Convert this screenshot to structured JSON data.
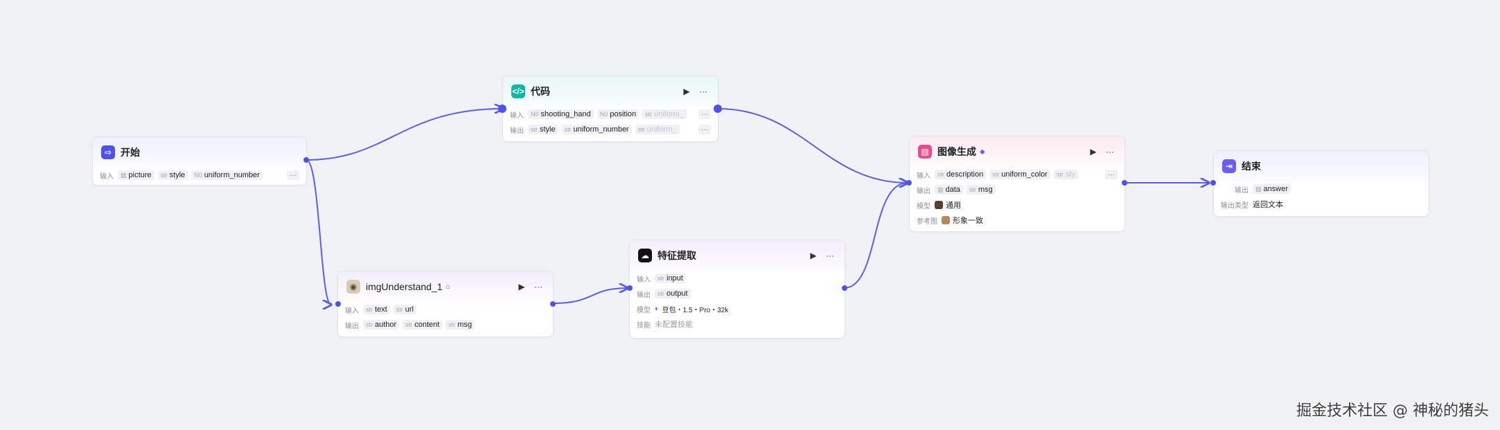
{
  "nodes": {
    "start": {
      "title": "开始",
      "input_label": "输入",
      "inputs": [
        {
          "type": "img",
          "name": "picture"
        },
        {
          "type": "str",
          "name": "style"
        },
        {
          "type": "N0",
          "name": "uniform_number"
        }
      ],
      "more": "···"
    },
    "code": {
      "title": "代码",
      "input_label": "输入",
      "output_label": "输出",
      "inputs": [
        {
          "type": "N0",
          "name": "shooting_hand"
        },
        {
          "type": "N0",
          "name": "position"
        },
        {
          "type": "str",
          "name": "uniform_"
        }
      ],
      "outputs": [
        {
          "type": "str",
          "name": "style"
        },
        {
          "type": "str",
          "name": "uniform_number"
        },
        {
          "type": "str",
          "name": "uniform_"
        }
      ],
      "more": "···"
    },
    "img_understand": {
      "title": "imgUnderstand_1",
      "input_label": "输入",
      "output_label": "输出",
      "inputs": [
        {
          "type": "str",
          "name": "text"
        },
        {
          "type": "str",
          "name": "url"
        }
      ],
      "outputs": [
        {
          "type": "str",
          "name": "author"
        },
        {
          "type": "str",
          "name": "content"
        },
        {
          "type": "str",
          "name": "msg"
        }
      ]
    },
    "feature": {
      "title": "特征提取",
      "input_label": "输入",
      "output_label": "输出",
      "model_label": "模型",
      "skill_label": "技能",
      "inputs": [
        {
          "type": "str",
          "name": "input"
        }
      ],
      "outputs": [
        {
          "type": "str",
          "name": "output"
        }
      ],
      "model": "豆包・1.5・Pro・32k",
      "skill": "未配置技能"
    },
    "image_gen": {
      "title": "图像生成",
      "input_label": "输入",
      "output_label": "输出",
      "model_label": "模型",
      "ref_label": "参考图",
      "inputs": [
        {
          "type": "str",
          "name": "description"
        },
        {
          "type": "str",
          "name": "uniform_color"
        },
        {
          "type": "str",
          "name": "sty"
        }
      ],
      "outputs": [
        {
          "type": "img",
          "name": "data"
        },
        {
          "type": "str",
          "name": "msg"
        }
      ],
      "model": "通用",
      "ref": "形象一致",
      "more": "···"
    },
    "end": {
      "title": "结束",
      "output_label": "输出",
      "output_type_label": "输出类型",
      "outputs": [
        {
          "type": "img",
          "name": "answer"
        }
      ],
      "output_type": "返回文本"
    }
  },
  "watermark": "掘金技术社区 @ 神秘的猪头",
  "colors": {
    "edge": "#5a5fe0",
    "port": "#4d53e8"
  }
}
